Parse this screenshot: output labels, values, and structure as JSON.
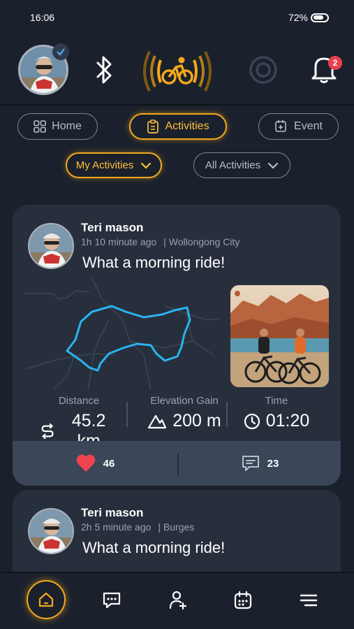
{
  "status_bar": {
    "time": "16:06",
    "battery": "72%"
  },
  "header": {
    "notification_count": "2",
    "icons": [
      "profile-avatar",
      "bluetooth-icon",
      "bike-live-icon",
      "ring-icon",
      "bell-icon"
    ]
  },
  "tabs": [
    {
      "label": "Home",
      "icon": "grid-icon"
    },
    {
      "label": "Activities",
      "icon": "clipboard-icon",
      "active": true
    },
    {
      "label": "Event",
      "icon": "calendar-add-icon"
    }
  ],
  "filters": {
    "my_activities": "My Activities",
    "all_activities": "All Activities"
  },
  "posts": [
    {
      "author": "Teri mason",
      "time_ago": "1h 10 minute ago",
      "location": "| Wollongong City",
      "title": "What a morning ride!",
      "stats": {
        "distance_label": "Distance",
        "distance_value": "45.2 km",
        "elevation_label": "Elevation Gain",
        "elevation_value": "200 m",
        "time_label": "Time",
        "time_value": "01:20"
      },
      "likes": "46",
      "comments": "23"
    },
    {
      "author": "Teri mason",
      "time_ago": "2h 5 minute ago",
      "location": "| Burges",
      "title": "What a morning ride!"
    }
  ],
  "colors": {
    "accent": "#f3a91c",
    "background": "#1b212c",
    "card": "#272f3d",
    "route": "#2ab4f0",
    "like": "#f0434f"
  },
  "bottom_nav": [
    "home-icon",
    "chat-icon",
    "add-friend-icon",
    "calendar-icon",
    "menu-icon"
  ]
}
